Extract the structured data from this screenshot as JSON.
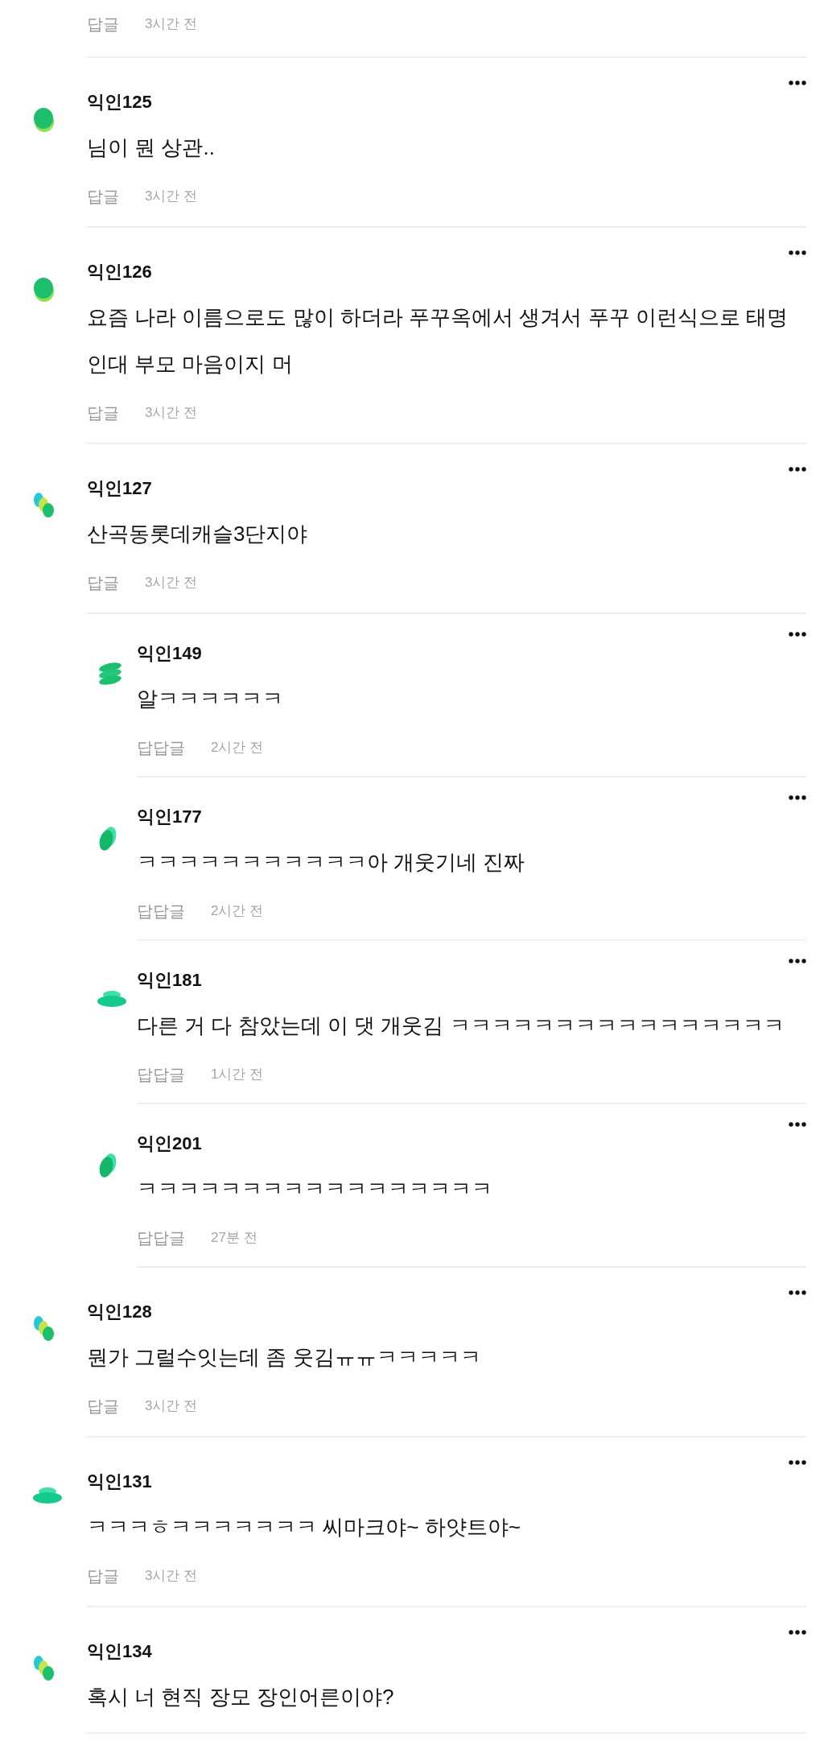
{
  "top_fragment": {
    "reply_label": "답글",
    "time": "3시간 전"
  },
  "comments": [
    {
      "avatar": {
        "kind": "blob"
      },
      "name": "익인125",
      "text": "님이 뭔 상관..",
      "reply_label": "답글",
      "time": "3시간 전"
    },
    {
      "avatar": {
        "kind": "blob"
      },
      "name": "익인126",
      "text": "요즘 나라 이름으로도 많이 하더라 푸꾸옥에서 생겨서 푸꾸 이런식으로 태명인대 부모 마음이지 머",
      "reply_label": "답글",
      "time": "3시간 전"
    },
    {
      "avatar": {
        "kind": "trio"
      },
      "name": "익인127",
      "text": "산곡동롯데캐슬3단지야",
      "reply_label": "답글",
      "time": "3시간 전",
      "children": [
        {
          "avatar": {
            "kind": "stack"
          },
          "name": "익인149",
          "text": "알ㅋㅋㅋㅋㅋㅋ",
          "reply_label": "답답글",
          "time": "2시간 전"
        },
        {
          "avatar": {
            "kind": "leaf"
          },
          "name": "익인177",
          "text": "ㅋㅋㅋㅋㅋㅋㅋㅋㅋㅋㅋ아 개웃기네 진짜",
          "reply_label": "답답글",
          "time": "2시간 전"
        },
        {
          "avatar": {
            "kind": "disc"
          },
          "name": "익인181",
          "text": "다른 거 다 참았는데 이 댓 개웃김 ㅋㅋㅋㅋㅋㅋㅋㅋㅋㅋㅋㅋㅋㅋㅋㅋ",
          "reply_label": "답답글",
          "time": "1시간 전"
        },
        {
          "avatar": {
            "kind": "leaf"
          },
          "name": "익인201",
          "text": "ㅋㅋㅋㅋㅋㅋㅋㅋㅋㅋㅋㅋㅋㅋㅋㅋㅋ",
          "reply_label": "답답글",
          "time": "27분 전"
        }
      ]
    },
    {
      "avatar": {
        "kind": "trio"
      },
      "name": "익인128",
      "text": "뭔가 그럴수잇는데 좀 웃김ㅠㅠㅋㅋㅋㅋㅋ",
      "reply_label": "답글",
      "time": "3시간 전"
    },
    {
      "avatar": {
        "kind": "disc"
      },
      "name": "익인131",
      "text": "ㅋㅋㅋㅎㅋㅋㅋㅋㅋㅋㅋ 씨마크야~ 하얏트야~",
      "reply_label": "답글",
      "time": "3시간 전"
    },
    {
      "avatar": {
        "kind": "trio"
      },
      "name": "익인134",
      "text": "혹시 너 현직 장모 장인어른이야?"
    }
  ]
}
